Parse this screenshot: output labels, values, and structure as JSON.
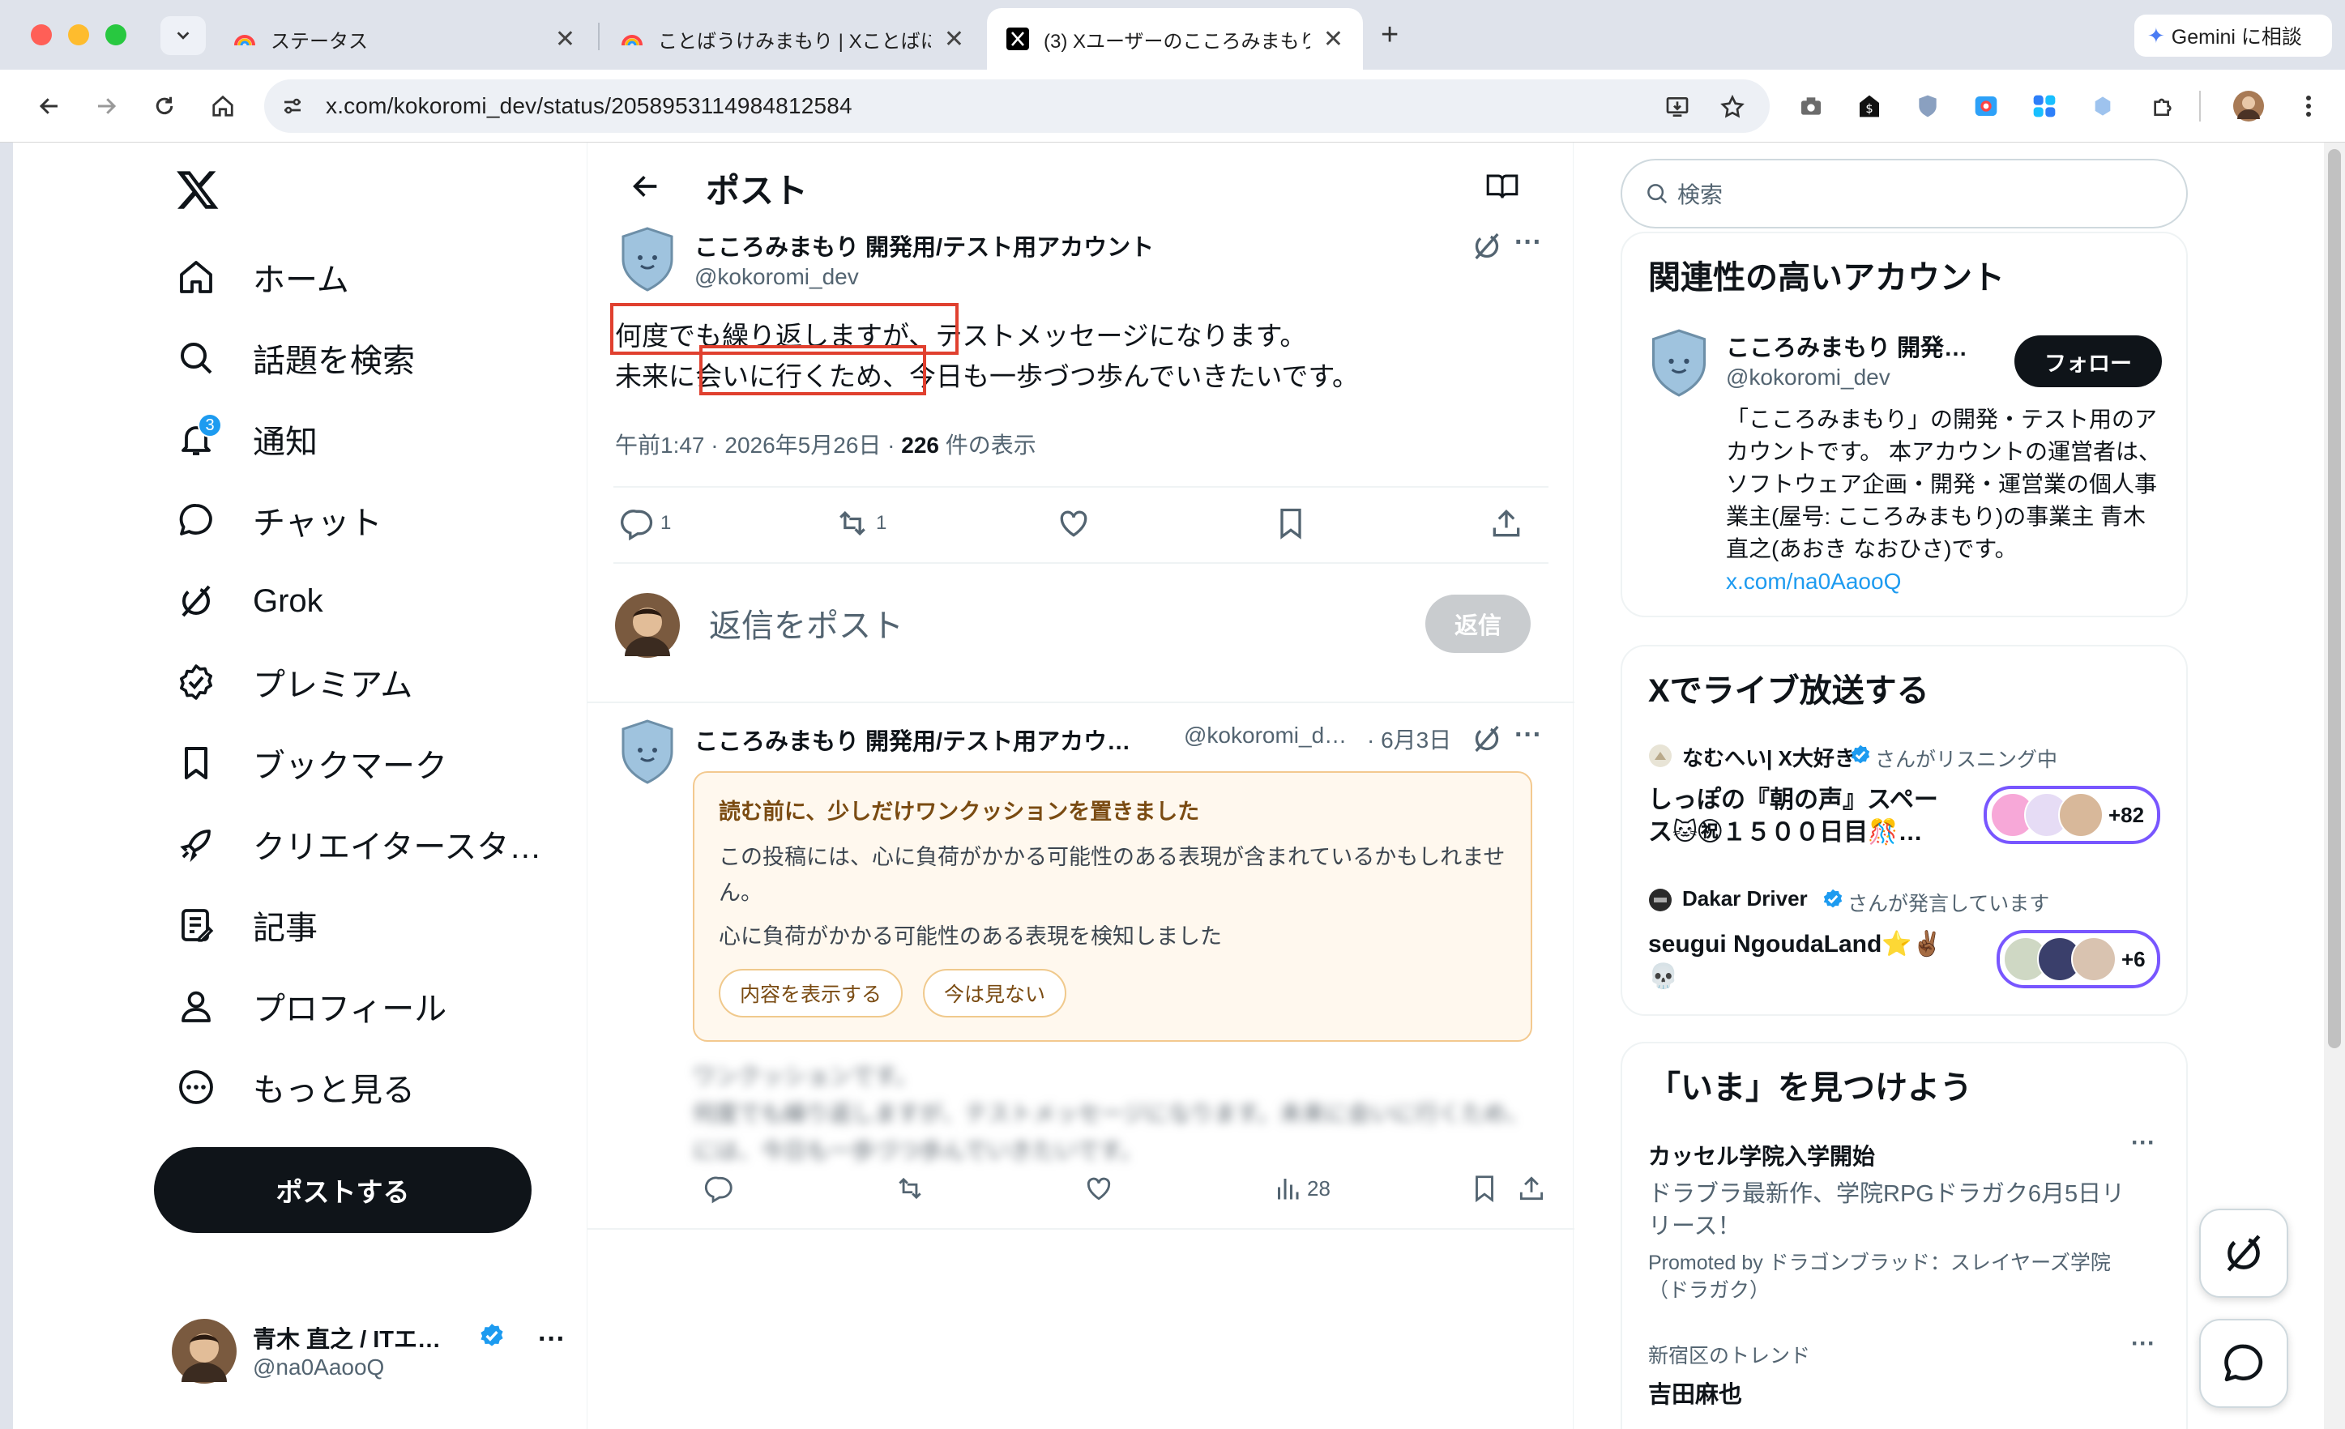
{
  "browser": {
    "tabs": [
      {
        "title": "ステータス",
        "active": false
      },
      {
        "title": "ことばうけみまもり | Xことばに",
        "active": false
      },
      {
        "title": "(3) Xユーザーのこころみまもり",
        "active": true
      }
    ],
    "gemini_label": "Gemini に相談",
    "url": "x.com/kokoromi_dev/status/2058953114984812584"
  },
  "nav": {
    "items": [
      {
        "label": "ホーム",
        "icon": "home-icon"
      },
      {
        "label": "話題を検索",
        "icon": "search-icon"
      },
      {
        "label": "通知",
        "icon": "bell-icon",
        "badge": "3"
      },
      {
        "label": "チャット",
        "icon": "chat-icon"
      },
      {
        "label": "Grok",
        "icon": "grok-icon"
      },
      {
        "label": "プレミアム",
        "icon": "verified-icon"
      },
      {
        "label": "ブックマーク",
        "icon": "bookmark-icon"
      },
      {
        "label": "クリエイタースタ…",
        "icon": "rocket-icon"
      },
      {
        "label": "記事",
        "icon": "article-icon"
      },
      {
        "label": "プロフィール",
        "icon": "person-icon"
      },
      {
        "label": "もっと見る",
        "icon": "more-circle-icon"
      }
    ],
    "post_button": "ポストする",
    "account": {
      "name": "青木 直之 / ITエ…",
      "handle": "@na0AaooQ"
    }
  },
  "header": {
    "title": "ポスト"
  },
  "tweet": {
    "name": "こころみまもり 開発用/テスト用アカウント",
    "handle": "@kokoromi_dev",
    "line1_highlight": "何度でも繰り返しますが、",
    "line1_rest": "テストメッセージになります。",
    "line2_start": "未来に",
    "line2_highlight": "会いに行くため、",
    "line2_rest": "今日も一歩づつ歩んでいきたいです。",
    "time": "午前1:47 · 2026年5月26日 · ",
    "views": "226",
    "views_label": " 件の表示",
    "replies": "1",
    "reposts": "1"
  },
  "reply_box": {
    "placeholder": "返信をポスト",
    "button": "返信"
  },
  "reply": {
    "name": "こころみまもり 開発用/テスト用アカウ…",
    "handle": "@kokoromi_d…",
    "date": "· 6月3日",
    "warning_title": "読む前に、少しだけワンクッションを置きました",
    "warning_body": "この投稿には、心に負荷がかかる可能性のある表現が含まれているかもしれません。",
    "warning_detected": "心に負荷がかかる可能性のある表現を検知しました",
    "show_button": "内容を表示する",
    "hide_button": "今は見ない",
    "blurred_line1": "ワンクッションです。",
    "blurred_line2": "何度でも繰り返しますが、テストメッセージになります。未来に会いに行くため、",
    "blurred_line3": "には、今日も一歩づつ歩んでいきたいです。",
    "views": "28"
  },
  "right": {
    "search_placeholder": "検索",
    "related": {
      "title": "関連性の高いアカウント",
      "name": "こころみまもり 開発…",
      "handle": "@kokoromi_dev",
      "follow": "フォロー",
      "bio": "「こころみまもり」の開発・テスト用のアカウントです。 本アカウントの運営者は、ソフトウェア企画・開発・運営業の個人事業主(屋号: こころみまもり)の事業主 青木 直之(あおき なおひさ)です。",
      "link": "x.com/na0AaooQ"
    },
    "live": {
      "title": "Xでライブ放送する",
      "spaces": [
        {
          "host": "なむへい| X大好き",
          "status": "さんがリスニング中",
          "title_line1": "しっぽの『朝の声』スペー",
          "title_line2": "ス🐱㊗１５００日目🎊…",
          "count": "+82"
        },
        {
          "host": "Dakar Driver",
          "status": "さんが発言しています",
          "title_line1": "seugui NgoudaLand⭐✌🏾",
          "title_line2": "💀",
          "count": "+6"
        }
      ]
    },
    "trends": {
      "title": "「いま」を見つけよう",
      "ad_title": "カッセル学院入学開始",
      "ad_body_line1": "ドラブラ最新作、学院RPGドラガク6月5日リ",
      "ad_body_line2": "リース！",
      "promoted_line1": "Promoted by ドラゴンブラッド：スレイヤーズ学院",
      "promoted_line2": "（ドラガク）",
      "trend_context": "新宿区のトレンド",
      "trend_name": "吉田麻也"
    }
  },
  "colors": {
    "accent": "#1d9bf0",
    "warning_bg": "#fff8ee",
    "warning_border": "#f3c98f",
    "highlight_box": "#e0402f",
    "live_ring": "#7856ff"
  }
}
